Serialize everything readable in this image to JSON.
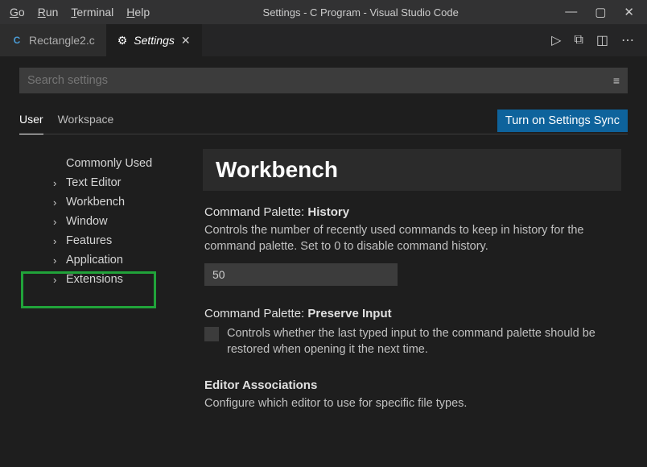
{
  "title_bar": {
    "menu": {
      "go": "Go",
      "run": "Run",
      "terminal": "Terminal",
      "help": "Help"
    },
    "window_title": "Settings - C Program - Visual Studio Code"
  },
  "tabs": {
    "file": "Rectangle2.c",
    "settings": "Settings"
  },
  "search": {
    "placeholder": "Search settings"
  },
  "scopes": {
    "user": "User",
    "workspace": "Workspace"
  },
  "sync_button": "Turn on Settings Sync",
  "tree": {
    "commonly_used": "Commonly Used",
    "text_editor": "Text Editor",
    "workbench": "Workbench",
    "window": "Window",
    "features": "Features",
    "application": "Application",
    "extensions": "Extensions"
  },
  "pane": {
    "header": "Workbench",
    "history": {
      "group": "Command Palette:",
      "name": "History",
      "desc": "Controls the number of recently used commands to keep in history for the command palette. Set to 0 to disable command history.",
      "value": "50"
    },
    "preserve": {
      "group": "Command Palette:",
      "name": "Preserve Input",
      "desc": "Controls whether the last typed input to the command palette should be restored when opening it the next time."
    },
    "editor_assoc": {
      "name": "Editor Associations",
      "desc": "Configure which editor to use for specific file types."
    }
  }
}
